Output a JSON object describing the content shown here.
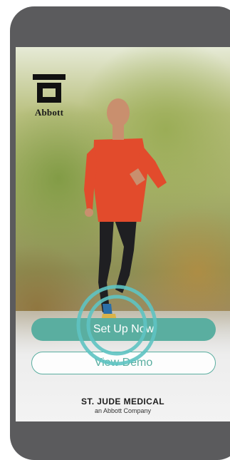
{
  "app": {
    "logo_text": "Abbott"
  },
  "actions": {
    "setup_label": "Set Up Now",
    "demo_label": "View Demo"
  },
  "footer": {
    "brand_name": "ST. JUDE MEDICAL",
    "brand_sub": "an Abbott Company"
  },
  "colors": {
    "accent": "#5aaea0",
    "frame": "#5b5b5d"
  },
  "icons": {
    "logo": "abbott-logo-icon",
    "tap_indicator": "tap-ring-icon"
  }
}
